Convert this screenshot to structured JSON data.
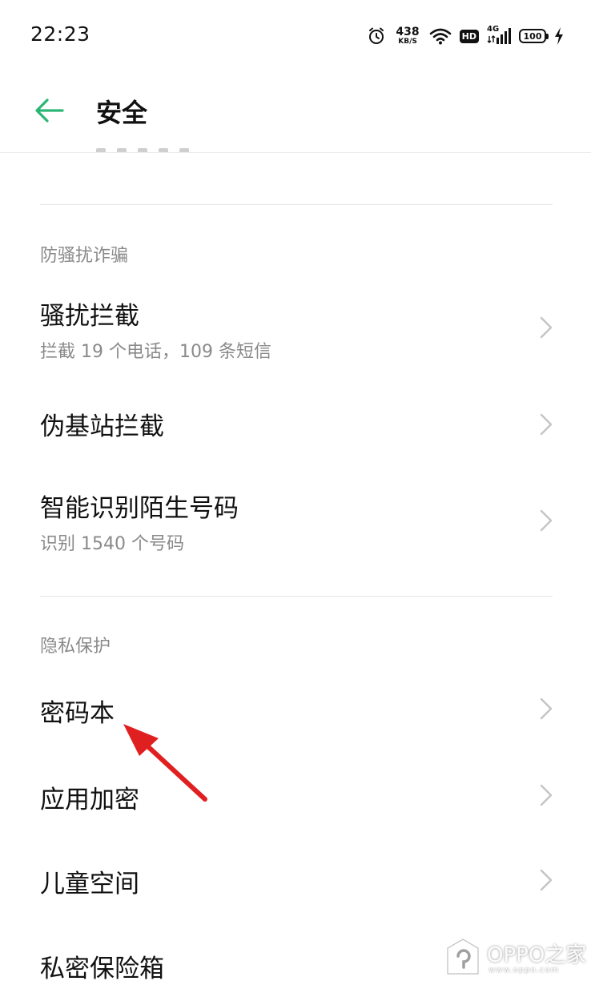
{
  "status_bar": {
    "time": "22:23",
    "net_speed_value": "438",
    "net_speed_unit": "KB/S",
    "hd_label": "HD",
    "signal_label": "4G",
    "battery_level": "100",
    "icons": [
      "alarm-icon",
      "wifi-icon",
      "hd-icon",
      "signal-4g-icon",
      "battery-icon",
      "charging-icon"
    ]
  },
  "header": {
    "title": "安全",
    "back_icon": "arrow-left-icon",
    "accent_color": "#2bb673"
  },
  "sections": [
    {
      "title": "防骚扰诈骗",
      "items": [
        {
          "title": "骚扰拦截",
          "subtitle": "拦截 19 个电话，109 条短信"
        },
        {
          "title": "伪基站拦截",
          "subtitle": ""
        },
        {
          "title": "智能识别陌生号码",
          "subtitle": "识别 1540 个号码"
        }
      ]
    },
    {
      "title": "隐私保护",
      "items": [
        {
          "title": "密码本",
          "subtitle": ""
        },
        {
          "title": "应用加密",
          "subtitle": ""
        },
        {
          "title": "儿童空间",
          "subtitle": ""
        },
        {
          "title": "私密保险箱",
          "subtitle": ""
        }
      ]
    }
  ],
  "annotation": {
    "color": "#e02020",
    "icon": "red-arrow-annotation"
  },
  "watermark": {
    "text": "OPPO之家",
    "url": "www.oppo.com"
  }
}
